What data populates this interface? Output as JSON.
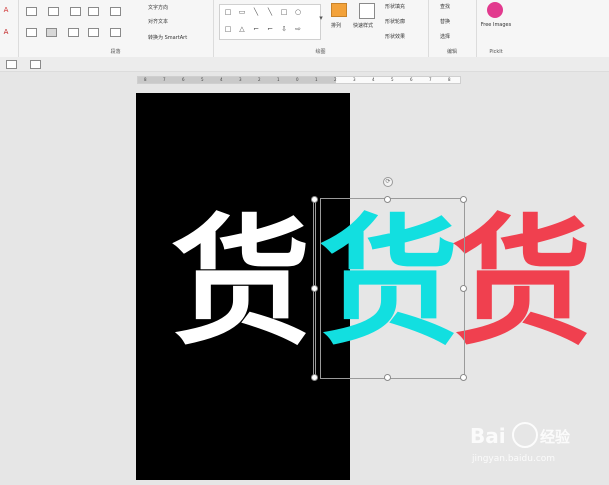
{
  "ribbon": {
    "paragraph_group_label": "段落",
    "drawing_group_label": "绘图",
    "editing_group_label": "编辑",
    "pickit_group_label": "PickIt",
    "text_direction_label": "文字方向",
    "align_text_label": "对齐文本",
    "convert_smartart_label": "转换为 SmartArt",
    "arrange_label": "排列",
    "quick_styles_label": "快速样式",
    "shape_fill_label": "形状填充",
    "shape_outline_label": "形状轮廓",
    "shape_effects_label": "形状效果",
    "find_label": "查找",
    "replace_label": "替换",
    "select_label": "选择",
    "free_images_label": "Free Images"
  },
  "ruler": {
    "ticks": [
      "8",
      "7",
      "6",
      "5",
      "4",
      "3",
      "2",
      "1",
      "0",
      "1",
      "2",
      "3",
      "4",
      "5",
      "6",
      "7",
      "8"
    ]
  },
  "slide": {
    "glyph_white": "货",
    "glyph_cyan": "货",
    "glyph_red": "货",
    "colors": {
      "background": "#000000",
      "white": "#ffffff",
      "cyan": "#12dfe0",
      "red": "#f0404f"
    }
  },
  "watermark": {
    "brand": "Bai",
    "brand2": "经验",
    "url": "jingyan.baidu.com"
  }
}
